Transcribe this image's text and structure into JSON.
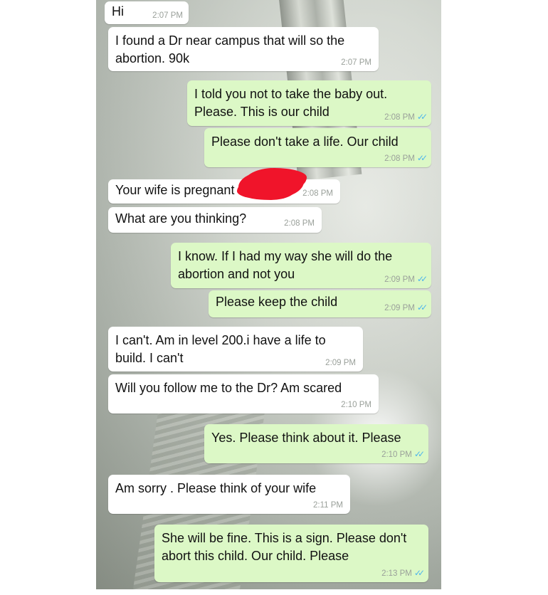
{
  "messages": [
    {
      "dir": "in",
      "text": "Hi",
      "time": "2:07 PM",
      "ticks": ""
    },
    {
      "dir": "in",
      "text": "I found a Dr near campus that will so the abortion. 90k",
      "time": "2:07 PM",
      "ticks": ""
    },
    {
      "dir": "out",
      "text": "I told you not to take the baby out. Please. This is our child",
      "time": "2:08 PM",
      "ticks": "✓✓"
    },
    {
      "dir": "out",
      "text": "Please don't take a life. Our child",
      "time": "2:08 PM",
      "ticks": "✓✓"
    },
    {
      "dir": "in",
      "text": "Your wife is pregnant",
      "time": "2:08 PM",
      "ticks": ""
    },
    {
      "dir": "in",
      "text": "What are you thinking?",
      "time": "2:08 PM",
      "ticks": ""
    },
    {
      "dir": "out",
      "text": "I know. If I had my way she will do the abortion and not you",
      "time": "2:09 PM",
      "ticks": "✓✓"
    },
    {
      "dir": "out",
      "text": "Please keep the child",
      "time": "2:09 PM",
      "ticks": "✓✓"
    },
    {
      "dir": "in",
      "text": "I can't. Am in level 200.i have a life to build. I can't",
      "time": "2:09 PM",
      "ticks": ""
    },
    {
      "dir": "in",
      "text": "Will you follow me to the Dr? Am scared",
      "time": "2:10 PM",
      "ticks": ""
    },
    {
      "dir": "out",
      "text": "Yes. Please think about it. Please",
      "time": "2:10 PM",
      "ticks": "✓✓"
    },
    {
      "dir": "in",
      "text": "Am sorry . Please think of your wife",
      "time": "2:11 PM",
      "ticks": ""
    },
    {
      "dir": "out",
      "text": "She will be fine. This is a sign. Please don't abort this child. Our child. Please",
      "time": "2:13 PM",
      "ticks": "✓✓"
    }
  ],
  "colors": {
    "incoming_bubble": "#ffffff",
    "outgoing_bubble": "#dcf8c6",
    "read_ticks": "#4fb6ec",
    "redaction": "#f0142a"
  }
}
